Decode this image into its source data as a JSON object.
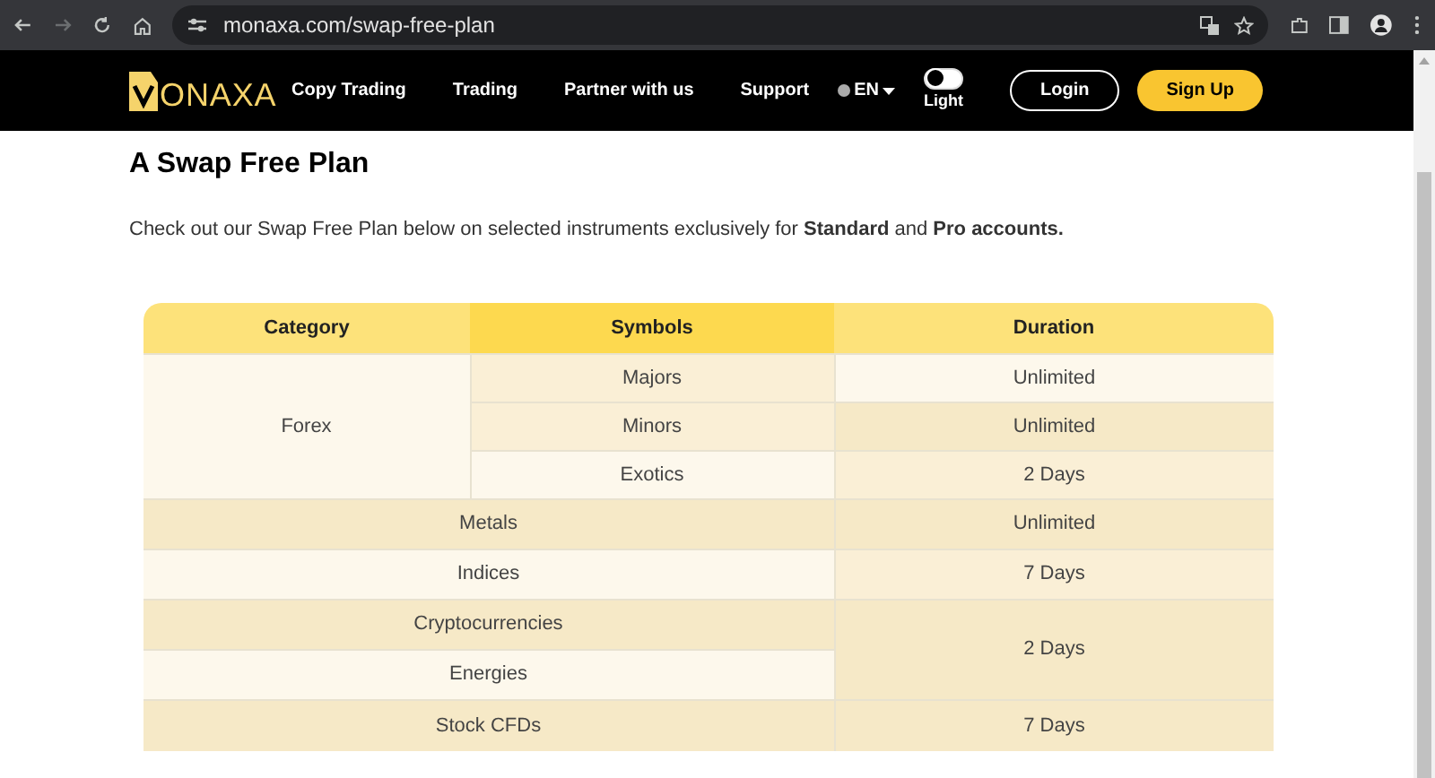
{
  "browser": {
    "url": "monaxa.com/swap-free-plan"
  },
  "nav": {
    "logo": "ONAXA",
    "links": [
      "Copy Trading",
      "Trading",
      "Partner with us",
      "Support"
    ],
    "language": "EN",
    "theme_toggle": {
      "label": "Light",
      "on": false
    },
    "buttons": [
      {
        "label": "Login",
        "kind": "outline"
      },
      {
        "label": "Sign Up",
        "kind": "filled"
      }
    ]
  },
  "heading": "A Swap Free Plan",
  "intro": "Check out our Swap Free Plan below on selected instruments exclusively for **Standard** and **Pro accounts.**",
  "table": {
    "columns": [
      "Category",
      "Symbols",
      "Duration"
    ],
    "groups": [
      {
        "kind": "symbols",
        "category": "Forex",
        "symbols": [
          {
            "name": "Majors",
            "duration": "Unlimited"
          },
          {
            "name": "Minors",
            "duration": "Unlimited"
          },
          {
            "name": "Exotics",
            "duration": "2 Days"
          }
        ]
      },
      {
        "kind": "single",
        "category": "Metals",
        "duration": "Unlimited"
      },
      {
        "kind": "single",
        "category": "Indices",
        "duration": "7 Days"
      },
      {
        "kind": "shared",
        "categories": [
          "Cryptocurrencies",
          "Energies"
        ],
        "duration": "2 Days"
      },
      {
        "kind": "single",
        "category": "Stock CFDs",
        "duration": "7 Days"
      }
    ]
  }
}
